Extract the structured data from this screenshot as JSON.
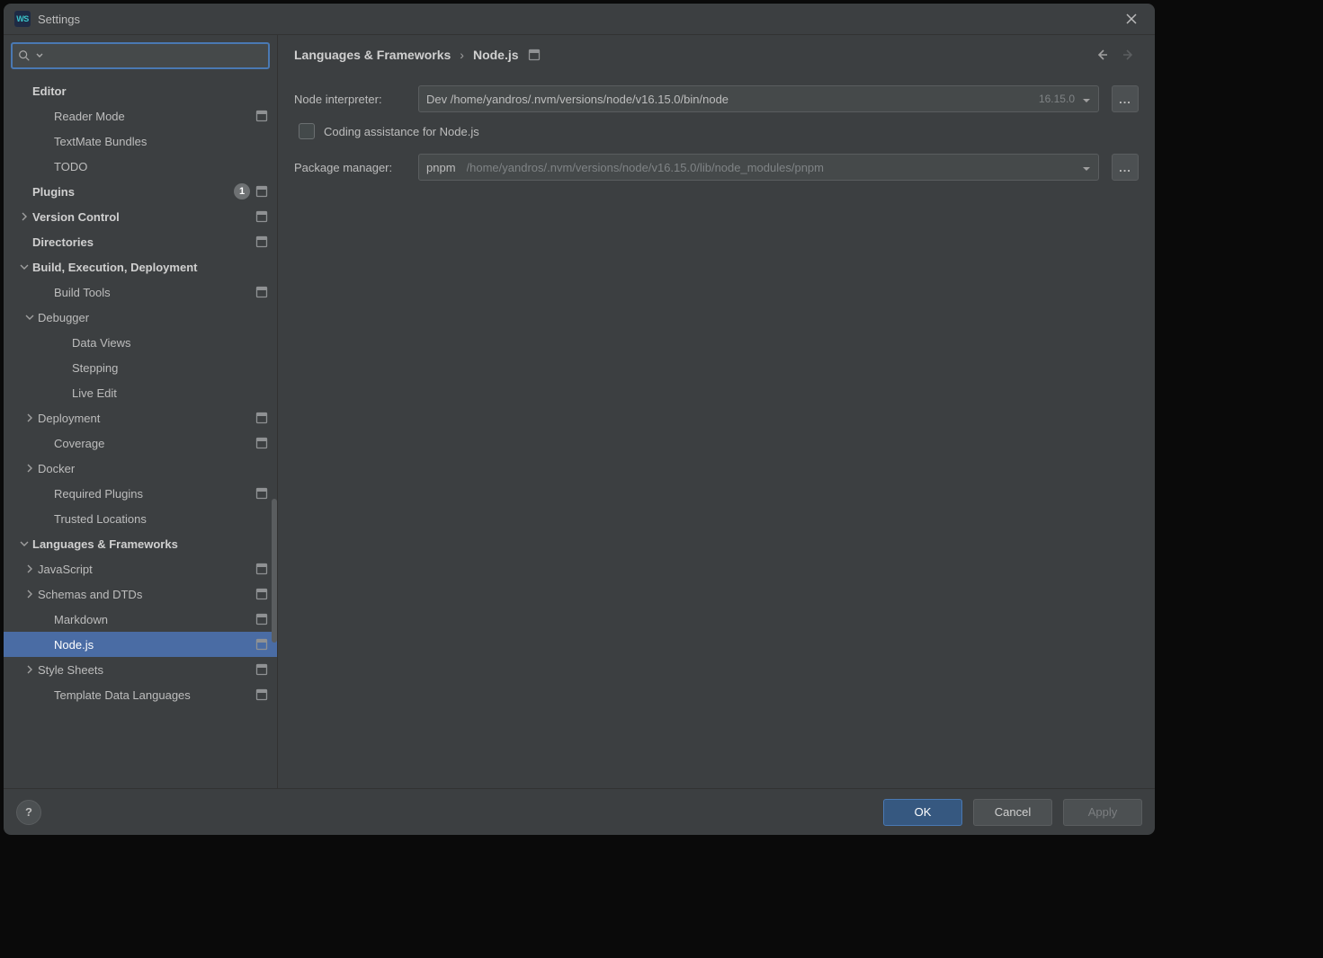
{
  "window": {
    "title": "Settings"
  },
  "search": {
    "placeholder": ""
  },
  "tree": [
    {
      "label": "Editor",
      "indent": 0,
      "bold": true,
      "chevron": null,
      "proj": false,
      "badge": null
    },
    {
      "label": "Reader Mode",
      "indent": 2,
      "bold": false,
      "chevron": null,
      "proj": true,
      "badge": null
    },
    {
      "label": "TextMate Bundles",
      "indent": 2,
      "bold": false,
      "chevron": null,
      "proj": false,
      "badge": null
    },
    {
      "label": "TODO",
      "indent": 2,
      "bold": false,
      "chevron": null,
      "proj": false,
      "badge": null
    },
    {
      "label": "Plugins",
      "indent": 0,
      "bold": true,
      "chevron": null,
      "proj": true,
      "badge": "1"
    },
    {
      "label": "Version Control",
      "indent": 0,
      "bold": true,
      "chevron": "right",
      "proj": true,
      "badge": null
    },
    {
      "label": "Directories",
      "indent": 0,
      "bold": true,
      "chevron": null,
      "proj": true,
      "badge": null
    },
    {
      "label": "Build, Execution, Deployment",
      "indent": 0,
      "bold": true,
      "chevron": "down",
      "proj": false,
      "badge": null
    },
    {
      "label": "Build Tools",
      "indent": 2,
      "bold": false,
      "chevron": null,
      "proj": true,
      "badge": null
    },
    {
      "label": "Debugger",
      "indent": 1,
      "bold": false,
      "chevron": "down",
      "proj": false,
      "badge": null
    },
    {
      "label": "Data Views",
      "indent": 3,
      "bold": false,
      "chevron": null,
      "proj": false,
      "badge": null
    },
    {
      "label": "Stepping",
      "indent": 3,
      "bold": false,
      "chevron": null,
      "proj": false,
      "badge": null
    },
    {
      "label": "Live Edit",
      "indent": 3,
      "bold": false,
      "chevron": null,
      "proj": false,
      "badge": null
    },
    {
      "label": "Deployment",
      "indent": 1,
      "bold": false,
      "chevron": "right",
      "proj": true,
      "badge": null
    },
    {
      "label": "Coverage",
      "indent": 2,
      "bold": false,
      "chevron": null,
      "proj": true,
      "badge": null
    },
    {
      "label": "Docker",
      "indent": 1,
      "bold": false,
      "chevron": "right",
      "proj": false,
      "badge": null
    },
    {
      "label": "Required Plugins",
      "indent": 2,
      "bold": false,
      "chevron": null,
      "proj": true,
      "badge": null
    },
    {
      "label": "Trusted Locations",
      "indent": 2,
      "bold": false,
      "chevron": null,
      "proj": false,
      "badge": null
    },
    {
      "label": "Languages & Frameworks",
      "indent": 0,
      "bold": true,
      "chevron": "down",
      "proj": false,
      "badge": null
    },
    {
      "label": "JavaScript",
      "indent": 1,
      "bold": false,
      "chevron": "right",
      "proj": true,
      "badge": null
    },
    {
      "label": "Schemas and DTDs",
      "indent": 1,
      "bold": false,
      "chevron": "right",
      "proj": true,
      "badge": null
    },
    {
      "label": "Markdown",
      "indent": 2,
      "bold": false,
      "chevron": null,
      "proj": true,
      "badge": null
    },
    {
      "label": "Node.js",
      "indent": 2,
      "bold": false,
      "chevron": null,
      "proj": true,
      "badge": null,
      "selected": true
    },
    {
      "label": "Style Sheets",
      "indent": 1,
      "bold": false,
      "chevron": "right",
      "proj": true,
      "badge": null
    },
    {
      "label": "Template Data Languages",
      "indent": 2,
      "bold": false,
      "chevron": null,
      "proj": true,
      "badge": null
    }
  ],
  "breadcrumb": {
    "root": "Languages & Frameworks",
    "leaf": "Node.js"
  },
  "form": {
    "interpreter": {
      "label": "Node interpreter:",
      "value": "Dev /home/yandros/.nvm/versions/node/v16.15.0/bin/node",
      "version": "16.15.0"
    },
    "coding_assist": "Coding assistance for Node.js",
    "package_manager": {
      "label": "Package manager:",
      "value": "pnpm",
      "path": "/home/yandros/.nvm/versions/node/v16.15.0/lib/node_modules/pnpm"
    },
    "browse": "..."
  },
  "footer": {
    "ok": "OK",
    "cancel": "Cancel",
    "apply": "Apply"
  }
}
